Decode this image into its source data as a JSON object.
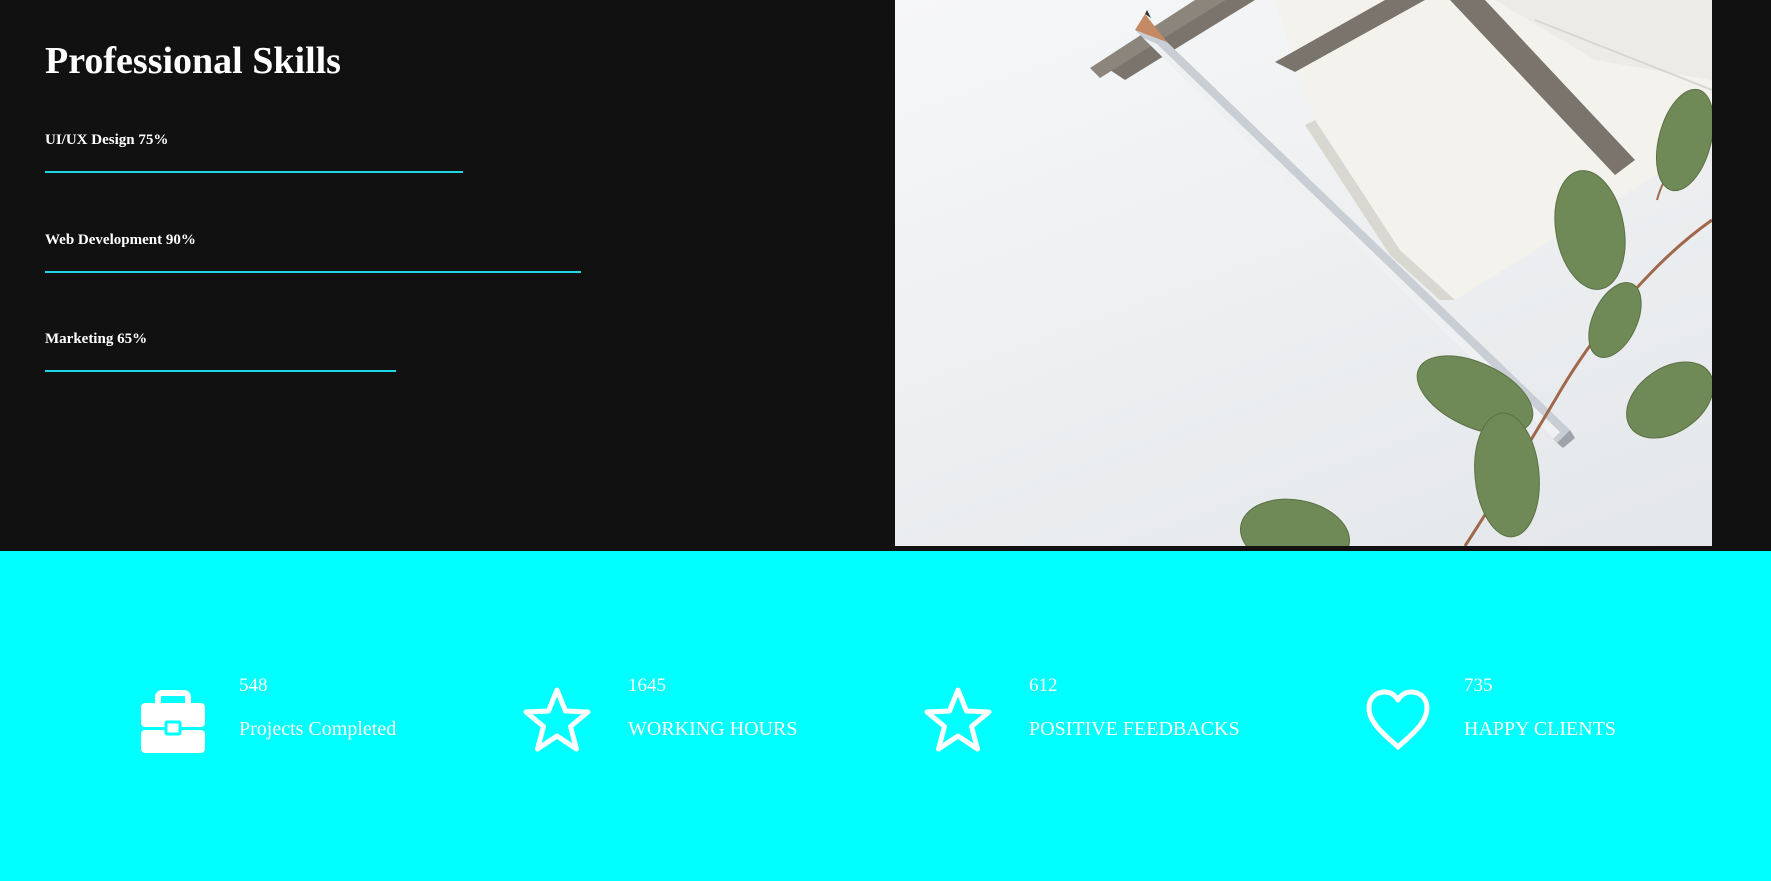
{
  "skills": {
    "title": "Professional Skills",
    "items": [
      {
        "label": "UI/UX Design 75%",
        "percent": 75
      },
      {
        "label": "Web Development 90%",
        "percent": 90
      },
      {
        "label": "Marketing 65%",
        "percent": 65
      }
    ],
    "bar_color": "#1fd6e6"
  },
  "stats": {
    "background": "#00ffff",
    "items": [
      {
        "number": "548",
        "label": "Projects Completed",
        "icon": "briefcase-icon"
      },
      {
        "number": "1645",
        "label": "WORKING HOURS",
        "icon": "star-icon"
      },
      {
        "number": "612",
        "label": "POSITIVE FEEDBACKS",
        "icon": "star-icon"
      },
      {
        "number": "735",
        "label": "HAPPY CLIENTS",
        "icon": "heart-icon"
      }
    ]
  }
}
